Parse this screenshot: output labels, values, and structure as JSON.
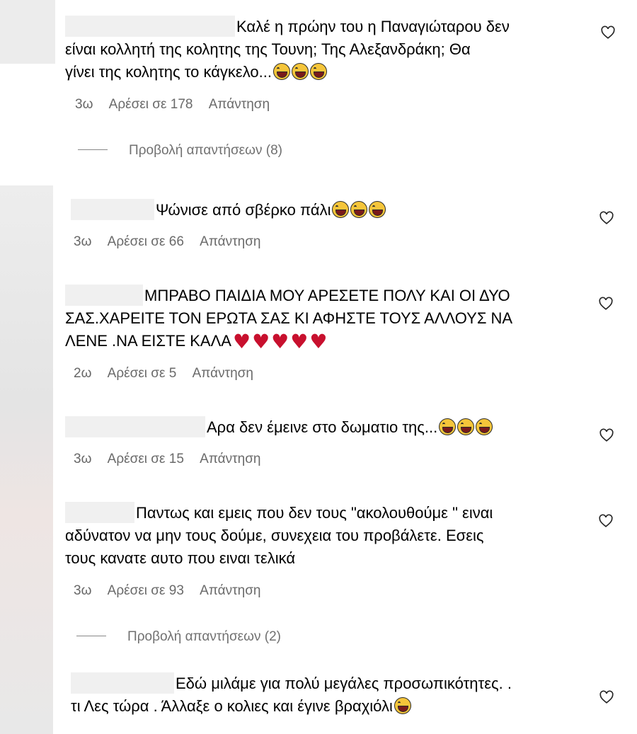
{
  "comments": [
    {
      "lines": [
        "Καλέ η πρώην του η Παναγιώταρου δεν",
        "είναι κολλητή της κολητης της Τουνη; Της Αλεξανδράκη; Θα",
        "γίνει της κολητης το κάγκελο..."
      ],
      "emoji": [
        "grinning-sweat-emoji",
        "grinning-sweat-emoji",
        "grinning-sweat-emoji"
      ],
      "age": "3ω",
      "likes": "Αρέσει σε 178",
      "reply": "Απάντηση"
    },
    {
      "lines": [
        "Ψώνισε από σβέρκο πάλι"
      ],
      "emoji": [
        "grinning-sweat-emoji",
        "grinning-sweat-emoji",
        "grinning-sweat-emoji"
      ],
      "age": "3ω",
      "likes": "Αρέσει σε 66",
      "reply": "Απάντηση"
    },
    {
      "lines": [
        "ΜΠΡΑΒΟ ΠΑΙΔΙΑ ΜΟΥ ΑΡΕΣΕΤΕ ΠΟΛΥ ΚΑΙ ΟΙ ΔΥΟ",
        "ΣΑΣ.ΧΑΡΕΙΤΕ ΤΟΝ ΕΡΩΤΑ ΣΑΣ ΚΙ ΑΦΗΣΤΕ ΤΟΥΣ ΑΛΛΟΥΣ ΝΑ",
        "ΛΕΝΕ .ΝΑ ΕΙΣΤΕ ΚΑΛΑ"
      ],
      "emoji": [
        "red-heart-emoji",
        "red-heart-emoji",
        "red-heart-emoji",
        "red-heart-emoji",
        "red-heart-emoji"
      ],
      "age": "2ω",
      "likes": "Αρέσει σε 5",
      "reply": "Απάντηση"
    },
    {
      "lines": [
        "Αρα δεν έμεινε στο δωματιο της..."
      ],
      "emoji": [
        "grinning-sweat-emoji",
        "grinning-sweat-emoji",
        "grinning-sweat-emoji"
      ],
      "age": "3ω",
      "likes": "Αρέσει σε 15",
      "reply": "Απάντηση"
    },
    {
      "lines": [
        "Παντως και εμεις που δεν τους \"ακολουθούμε \" ειναι",
        "αδύνατον να μην τους δούμε, συνεχεια του προβάλετε. Εσεις",
        "τους κανατε αυτο που ειναι τελικά"
      ],
      "emoji": [],
      "age": "3ω",
      "likes": "Αρέσει σε 93",
      "reply": "Απάντηση"
    },
    {
      "lines": [
        "Εδώ μιλάμε για πολύ μεγάλες προσωπικότητες. .",
        "τι Λες τώρα . Άλλαξε ο κολιες και έγινε βραχιόλι"
      ],
      "emoji": [
        "grinning-sweat-emoji"
      ],
      "age": "",
      "likes": "",
      "reply": ""
    }
  ],
  "view_replies": [
    "Προβολή απαντήσεων (8)",
    "Προβολή απαντήσεων (2)"
  ],
  "icons": {
    "like": "heart-outline-icon"
  },
  "colors": {
    "meta": "#666666",
    "heart_emoji": "#c8102e",
    "laugh_emoji": "#f5c53a"
  }
}
